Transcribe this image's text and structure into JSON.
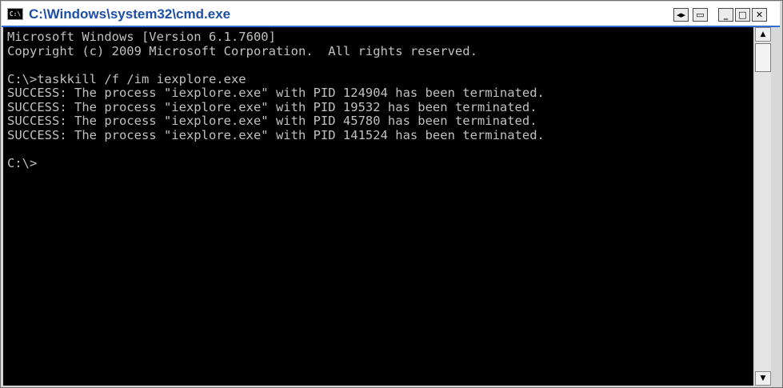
{
  "window": {
    "title": "C:\\Windows\\system32\\cmd.exe",
    "app_icon_text": "C:\\"
  },
  "titlebar_buttons": {
    "back_glyph": "◂▸",
    "restore_glyph": "▭",
    "minimize_glyph": "_",
    "maximize_glyph": "□",
    "close_glyph": "✕"
  },
  "console": {
    "lines": [
      "Microsoft Windows [Version 6.1.7600]",
      "Copyright (c) 2009 Microsoft Corporation.  All rights reserved.",
      "",
      "C:\\>taskkill /f /im iexplore.exe",
      "SUCCESS: The process \"iexplore.exe\" with PID 124904 has been terminated.",
      "SUCCESS: The process \"iexplore.exe\" with PID 19532 has been terminated.",
      "SUCCESS: The process \"iexplore.exe\" with PID 45780 has been terminated.",
      "SUCCESS: The process \"iexplore.exe\" with PID 141524 has been terminated.",
      "",
      "C:\\>"
    ]
  },
  "scrollbar": {
    "up_glyph": "▲",
    "down_glyph": "▼"
  },
  "colors": {
    "console_background": "#000000",
    "console_text": "#c0c0c0",
    "title_text": "#1d4fa6"
  },
  "icons": {
    "app": "cmd-icon",
    "up": "scroll-up-arrow-icon",
    "down": "scroll-down-arrow-icon"
  }
}
